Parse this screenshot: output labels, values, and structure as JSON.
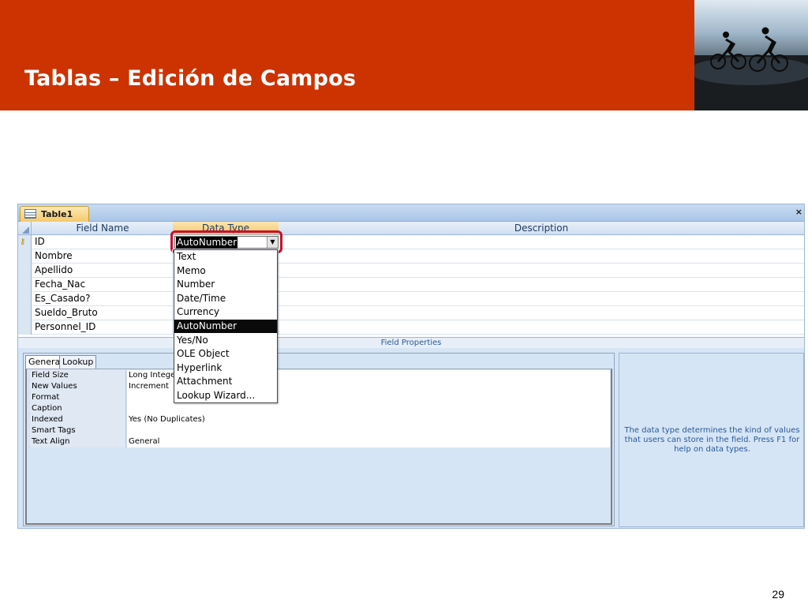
{
  "slide": {
    "title": "Tablas – Edición de Campos",
    "page_number": "29",
    "header_color": "#cc3300"
  },
  "window": {
    "tab_label": "Table1",
    "close_glyph": "×"
  },
  "grid": {
    "columns": [
      "Field Name",
      "Data Type",
      "Description"
    ],
    "rows": [
      {
        "field": "ID",
        "primary_key": true
      },
      {
        "field": "Nombre"
      },
      {
        "field": "Apellido"
      },
      {
        "field": "Fecha_Nac"
      },
      {
        "field": "Es_Casado?"
      },
      {
        "field": "Sueldo_Bruto"
      },
      {
        "field": "Personnel_ID"
      }
    ],
    "current_data_type": "AutoNumber"
  },
  "dropdown": {
    "options": [
      "Text",
      "Memo",
      "Number",
      "Date/Time",
      "Currency",
      "AutoNumber",
      "Yes/No",
      "OLE Object",
      "Hyperlink",
      "Attachment",
      "Lookup Wizard..."
    ],
    "selected": "AutoNumber"
  },
  "field_properties": {
    "bar_label": "Field Properties",
    "tabs": [
      "General",
      "Lookup"
    ],
    "active_tab": "General",
    "rows": [
      {
        "label": "Field Size",
        "value": "Long Integer"
      },
      {
        "label": "New Values",
        "value": "Increment"
      },
      {
        "label": "Format",
        "value": ""
      },
      {
        "label": "Caption",
        "value": ""
      },
      {
        "label": "Indexed",
        "value": "Yes (No Duplicates)"
      },
      {
        "label": "Smart Tags",
        "value": ""
      },
      {
        "label": "Text Align",
        "value": "General"
      }
    ],
    "help_text": "The data type determines the kind of values that users can store in the field.  Press F1 for help on data types."
  }
}
